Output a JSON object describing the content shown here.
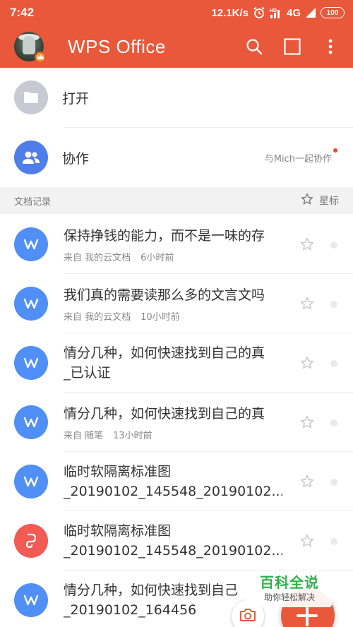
{
  "status_bar": {
    "time": "7:42",
    "net_speed": "12.1K/s",
    "network": "4G",
    "battery": "100"
  },
  "app_bar": {
    "title": "WPS Office",
    "icons": [
      "search-icon",
      "multiwindow-icon",
      "more-vert-icon"
    ],
    "color": "#e9583a"
  },
  "quick_actions": [
    {
      "label": "打开",
      "icon": "folder-icon",
      "color": "#c9c9d3"
    },
    {
      "label": "协作",
      "icon": "people-icon",
      "color": "#4f7dea",
      "note": "与Mich一起协作"
    }
  ],
  "records_header": {
    "title": "文档记录",
    "star_label": "星标"
  },
  "records": [
    {
      "title": "保持挣钱的能力，而不是一味的存",
      "source": "来自 我的云文档",
      "time": "6小时前",
      "type": "word"
    },
    {
      "title": "我们真的需要读那么多的文言文吗",
      "source": "来自 我的云文档",
      "time": "10小时前",
      "type": "word"
    },
    {
      "title": "情分几种，如何快速找到自己的真",
      "title2": "_已认证",
      "type": "word"
    },
    {
      "title": "情分几种，如何快速找到自己的真",
      "source": "来自 随笔",
      "time": "13小时前",
      "type": "word"
    },
    {
      "title": "临时软隔离标准图",
      "title2": "_20190102_145548_20190102...",
      "type": "word"
    },
    {
      "title": "临时软隔离标准图",
      "title2": "_20190102_145548_20190102...",
      "type": "pdf"
    },
    {
      "title": "情分几种，如何快速找到自己",
      "title2": "_20190102_164456",
      "type": "word"
    }
  ],
  "colors": {
    "word": "#4f8ff7",
    "pdf": "#f25a55"
  },
  "watermark": {
    "title": "百科全说",
    "subtitle": "助你轻松解决"
  }
}
